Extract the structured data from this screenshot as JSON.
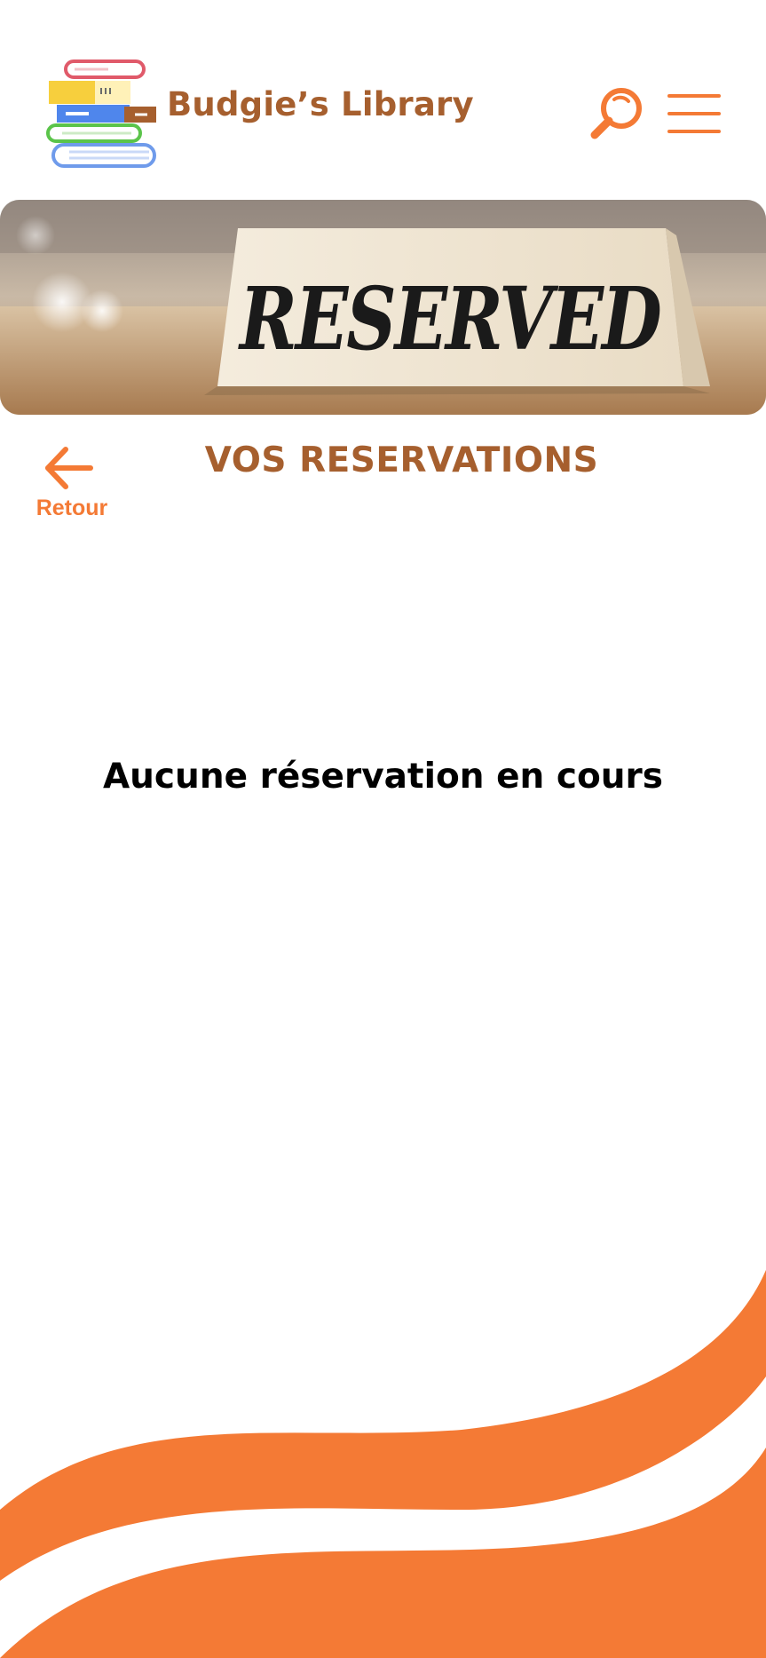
{
  "header": {
    "brand_title": "Budgie’s Library",
    "search_icon": "search-icon",
    "menu_icon": "hamburger-menu-icon"
  },
  "banner": {
    "sign_text": "RESERVED"
  },
  "main": {
    "back_label": "Retour",
    "title": "VOS RESERVATIONS",
    "empty_message": "Aucune réservation en cours"
  },
  "colors": {
    "accent": "#F47A35",
    "brand_brown": "#A65F2E",
    "text": "#000000",
    "background": "#FFFFFF"
  }
}
